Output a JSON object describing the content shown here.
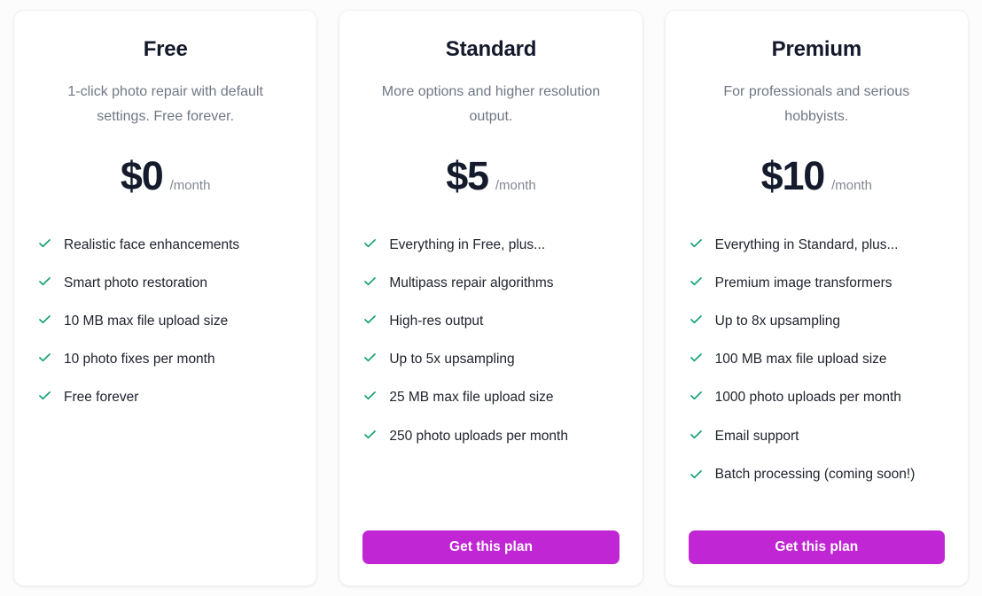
{
  "theme": {
    "page_background": "#fcfcfd",
    "card_background": "#ffffff",
    "accent_button": "#c026d3",
    "check_color": "#0e9f6e",
    "title_color": "#14192b",
    "muted_text": "#717784"
  },
  "plans": [
    {
      "id": "free",
      "title": "Free",
      "subtitle": "1-click photo repair with default settings. Free forever.",
      "price": "$0",
      "period": "/month",
      "features": [
        "Realistic face enhancements",
        "Smart photo restoration",
        "10 MB max file upload size",
        "10 photo fixes per month",
        "Free forever"
      ],
      "cta_label": null
    },
    {
      "id": "standard",
      "title": "Standard",
      "subtitle": "More options and higher resolution output.",
      "price": "$5",
      "period": "/month",
      "features": [
        "Everything in Free, plus...",
        "Multipass repair algorithms",
        "High-res output",
        "Up to 5x upsampling",
        "25 MB max file upload size",
        "250 photo uploads per month"
      ],
      "cta_label": "Get this plan"
    },
    {
      "id": "premium",
      "title": "Premium",
      "subtitle": "For professionals and serious hobbyists.",
      "price": "$10",
      "period": "/month",
      "features": [
        "Everything in Standard, plus...",
        "Premium image transformers",
        "Up to 8x upsampling",
        "100 MB max file upload size",
        "1000 photo uploads per month",
        "Email support",
        "Batch processing (coming soon!)"
      ],
      "cta_label": "Get this plan"
    }
  ],
  "icons": {
    "check": "check-icon"
  }
}
